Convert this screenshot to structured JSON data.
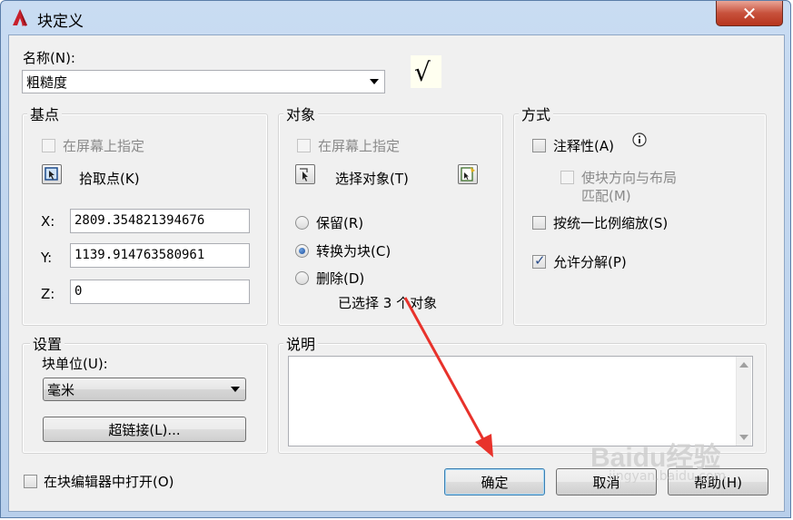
{
  "window": {
    "title": "块定义",
    "close_icon": "close-icon"
  },
  "name": {
    "label": "名称(N):",
    "value": "粗糙度",
    "preview_symbol": "√"
  },
  "base_point": {
    "title": "基点",
    "specify_on_screen": "在屏幕上指定",
    "pick_point": "拾取点(K)",
    "x_label": "X:",
    "x_value": "2809.354821394676",
    "y_label": "Y:",
    "y_value": "1139.914763580961",
    "z_label": "Z:",
    "z_value": "0"
  },
  "objects": {
    "title": "对象",
    "specify_on_screen": "在屏幕上指定",
    "select_objects": "选择对象(T)",
    "retain": "保留(R)",
    "convert_to_block": "转换为块(C)",
    "delete": "删除(D)",
    "selected_count_text": "已选择 3 个对象",
    "selected_option": "convert_to_block"
  },
  "behavior": {
    "title": "方式",
    "annotative": "注释性(A)",
    "match_orientation_line1": "使块方向与布局",
    "match_orientation_line2": "匹配(M)",
    "scale_uniformly": "按统一比例缩放(S)",
    "allow_exploding": "允许分解(P)",
    "allow_exploding_checked": true
  },
  "settings": {
    "title": "设置",
    "block_unit_label": "块单位(U):",
    "block_unit_value": "毫米",
    "hyperlink": "超链接(L)..."
  },
  "description": {
    "title": "说明",
    "value": ""
  },
  "footer": {
    "open_in_editor": "在块编辑器中打开(O)",
    "ok": "确定",
    "cancel": "取消",
    "help": "帮助(H)"
  },
  "watermark": {
    "text": "Baidu经验",
    "subtext": "jingyan.baidu.com"
  },
  "colors": {
    "annotation_arrow": "#e8322b",
    "title_bar": "#c9dcf2",
    "close_button": "#c8513c"
  }
}
